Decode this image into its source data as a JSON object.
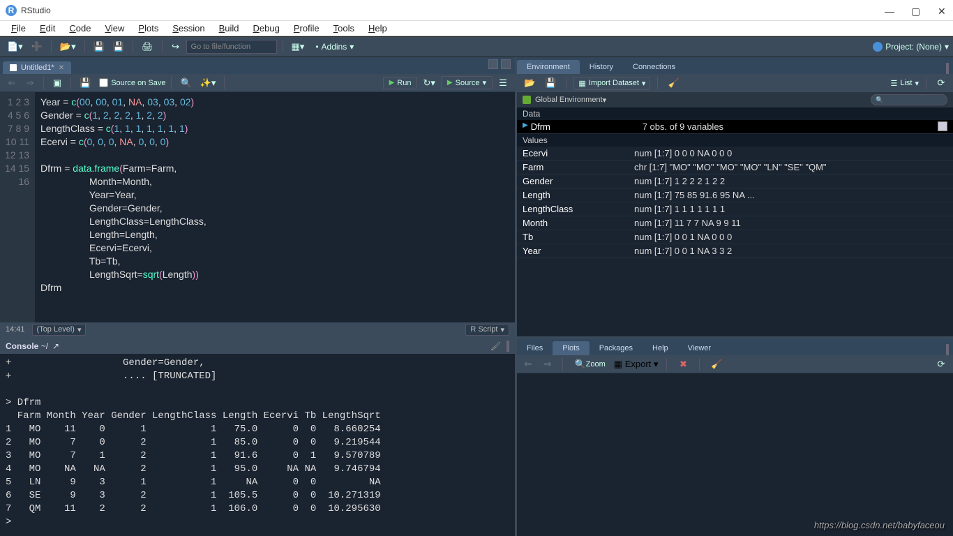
{
  "titlebar": {
    "app": "RStudio"
  },
  "menubar": [
    "File",
    "Edit",
    "Code",
    "View",
    "Plots",
    "Session",
    "Build",
    "Debug",
    "Profile",
    "Tools",
    "Help"
  ],
  "toolbar": {
    "gotofile_placeholder": "Go to file/function",
    "addins": "Addins",
    "project": "Project: (None)"
  },
  "source": {
    "tab_title": "Untitled1*",
    "source_on_save": "Source on Save",
    "run": "Run",
    "source_btn": "Source",
    "status_pos": "14:41",
    "status_scope": "(Top Level)",
    "status_lang": "R Script",
    "lines": [
      "Year = c(00, 00, 01, NA, 03, 03, 02)",
      "Gender = c(1, 2, 2, 2, 1, 2, 2)",
      "LengthClass = c(1, 1, 1, 1, 1, 1, 1)",
      "Ecervi = c(0, 0, 0, NA, 0, 0, 0)",
      "",
      "Dfrm = data.frame(Farm=Farm,",
      "                  Month=Month,",
      "                  Year=Year,",
      "                  Gender=Gender,",
      "                  LengthClass=LengthClass,",
      "                  Length=Length,",
      "                  Ecervi=Ecervi,",
      "                  Tb=Tb,",
      "                  LengthSqrt=sqrt(Length))",
      "Dfrm",
      ""
    ]
  },
  "console": {
    "header": "Console ~/",
    "lines": [
      "+                   Gender=Gender,",
      "+                   .... [TRUNCATED] ",
      "",
      "> Dfrm",
      "  Farm Month Year Gender LengthClass Length Ecervi Tb LengthSqrt",
      "1   MO    11    0      1           1   75.0      0  0   8.660254",
      "2   MO     7    0      2           1   85.0      0  0   9.219544",
      "3   MO     7    1      2           1   91.6      0  1   9.570789",
      "4   MO    NA   NA      2           1   95.0     NA NA   9.746794",
      "5   LN     9    3      1           1     NA      0  0         NA",
      "6   SE     9    3      2           1  105.5      0  0  10.271319",
      "7   QM    11    2      2           1  106.0      0  0  10.295630",
      "> "
    ]
  },
  "env": {
    "tabs": [
      "Environment",
      "History",
      "Connections"
    ],
    "import": "Import Dataset",
    "list": "List",
    "scope": "Global Environment",
    "sections": {
      "data_header": "Data",
      "values_header": "Values",
      "data_rows": [
        {
          "name": "Dfrm",
          "val": "7 obs. of 9 variables"
        }
      ],
      "value_rows": [
        {
          "name": "Ecervi",
          "val": "num [1:7] 0 0 0 NA 0 0 0"
        },
        {
          "name": "Farm",
          "val": "chr [1:7] \"MO\" \"MO\" \"MO\" \"MO\" \"LN\" \"SE\" \"QM\""
        },
        {
          "name": "Gender",
          "val": "num [1:7] 1 2 2 2 1 2 2"
        },
        {
          "name": "Length",
          "val": "num [1:7] 75 85 91.6 95 NA ..."
        },
        {
          "name": "LengthClass",
          "val": "num [1:7] 1 1 1 1 1 1 1"
        },
        {
          "name": "Month",
          "val": "num [1:7] 11 7 7 NA 9 9 11"
        },
        {
          "name": "Tb",
          "val": "num [1:7] 0 0 1 NA 0 0 0"
        },
        {
          "name": "Year",
          "val": "num [1:7] 0 0 1 NA 3 3 2"
        }
      ]
    }
  },
  "plots": {
    "tabs": [
      "Files",
      "Plots",
      "Packages",
      "Help",
      "Viewer"
    ],
    "zoom": "Zoom",
    "export": "Export"
  },
  "watermark": "https://blog.csdn.net/babyfaceou"
}
